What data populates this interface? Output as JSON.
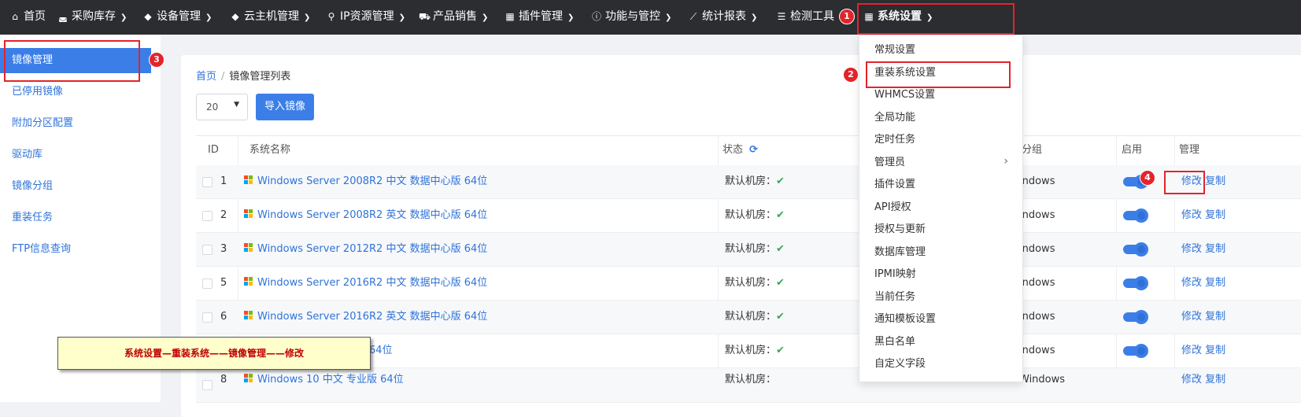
{
  "topnav": {
    "items": [
      {
        "label": "首页",
        "icon": "home-icon"
      },
      {
        "label": "采购库存",
        "icon": "cart-icon"
      },
      {
        "label": "设备管理",
        "icon": "cube-icon"
      },
      {
        "label": "云主机管理",
        "icon": "cube-icon"
      },
      {
        "label": "IP资源管理",
        "icon": "map-marker-icon"
      },
      {
        "label": "产品销售",
        "icon": "shopping-cart-icon"
      },
      {
        "label": "插件管理",
        "icon": "grid-icon"
      },
      {
        "label": "功能与管控",
        "icon": "info-icon"
      },
      {
        "label": "统计报表",
        "icon": "chart-line-icon"
      },
      {
        "label": "检测工具",
        "icon": "list-icon"
      },
      {
        "label": "系统设置",
        "icon": "grid-icon"
      }
    ]
  },
  "sidebar": {
    "items": [
      {
        "label": "镜像管理",
        "active": true
      },
      {
        "label": "已停用镜像"
      },
      {
        "label": "附加分区配置"
      },
      {
        "label": "驱动库"
      },
      {
        "label": "镜像分组"
      },
      {
        "label": "重装任务"
      },
      {
        "label": "FTP信息查询"
      }
    ]
  },
  "breadcrumb": {
    "home": "首页",
    "sep": "/",
    "current": "镜像管理列表"
  },
  "toolbar": {
    "page_size": "20",
    "import_label": "导入镜像"
  },
  "table": {
    "headers": {
      "id": "ID",
      "name": "系统名称",
      "status": "状态",
      "group": "分组",
      "enabled": "启用",
      "manage": "管理"
    },
    "edit_label": "修改",
    "copy_label": "复制",
    "rows": [
      {
        "id": "1",
        "name": "Windows Server 2008R2 中文 数据中心版 64位",
        "status": "默认机房：",
        "group": "indows"
      },
      {
        "id": "2",
        "name": "Windows Server 2008R2 英文 数据中心版 64位",
        "status": "默认机房：",
        "group": "indows"
      },
      {
        "id": "3",
        "name": "Windows Server 2012R2 中文 数据中心版 64位",
        "status": "默认机房：",
        "group": "indows"
      },
      {
        "id": "5",
        "name": "Windows Server 2016R2 中文 数据中心版 64位",
        "status": "默认机房：",
        "group": "indows"
      },
      {
        "id": "6",
        "name": "Windows Server 2016R2 英文 数据中心版 64位",
        "status": "默认机房：",
        "group": "indows"
      },
      {
        "id": "",
        "name": "64位",
        "status": "默认机房：",
        "group": "indows"
      },
      {
        "id": "8",
        "name": "Windows 10 中文 专业版 64位",
        "status": "默认机房：",
        "group": "Windows"
      }
    ]
  },
  "dropdown": {
    "items": [
      {
        "label": "常规设置"
      },
      {
        "label": "重装系统设置"
      },
      {
        "label": "WHMCS设置"
      },
      {
        "label": "全局功能"
      },
      {
        "label": "定时任务"
      },
      {
        "label": "管理员",
        "has_submenu": true
      },
      {
        "label": "插件设置"
      },
      {
        "label": "API授权"
      },
      {
        "label": "授权与更新"
      },
      {
        "label": "数据库管理"
      },
      {
        "label": "IPMI映射"
      },
      {
        "label": "当前任务"
      },
      {
        "label": "通知模板设置"
      },
      {
        "label": "黑白名单"
      },
      {
        "label": "自定义字段"
      }
    ]
  },
  "annotations": {
    "badges": [
      "1",
      "2",
      "3",
      "4"
    ],
    "note": "系统设置—重装系统——镜像管理——修改",
    "highlight_color": "#e3242b"
  }
}
